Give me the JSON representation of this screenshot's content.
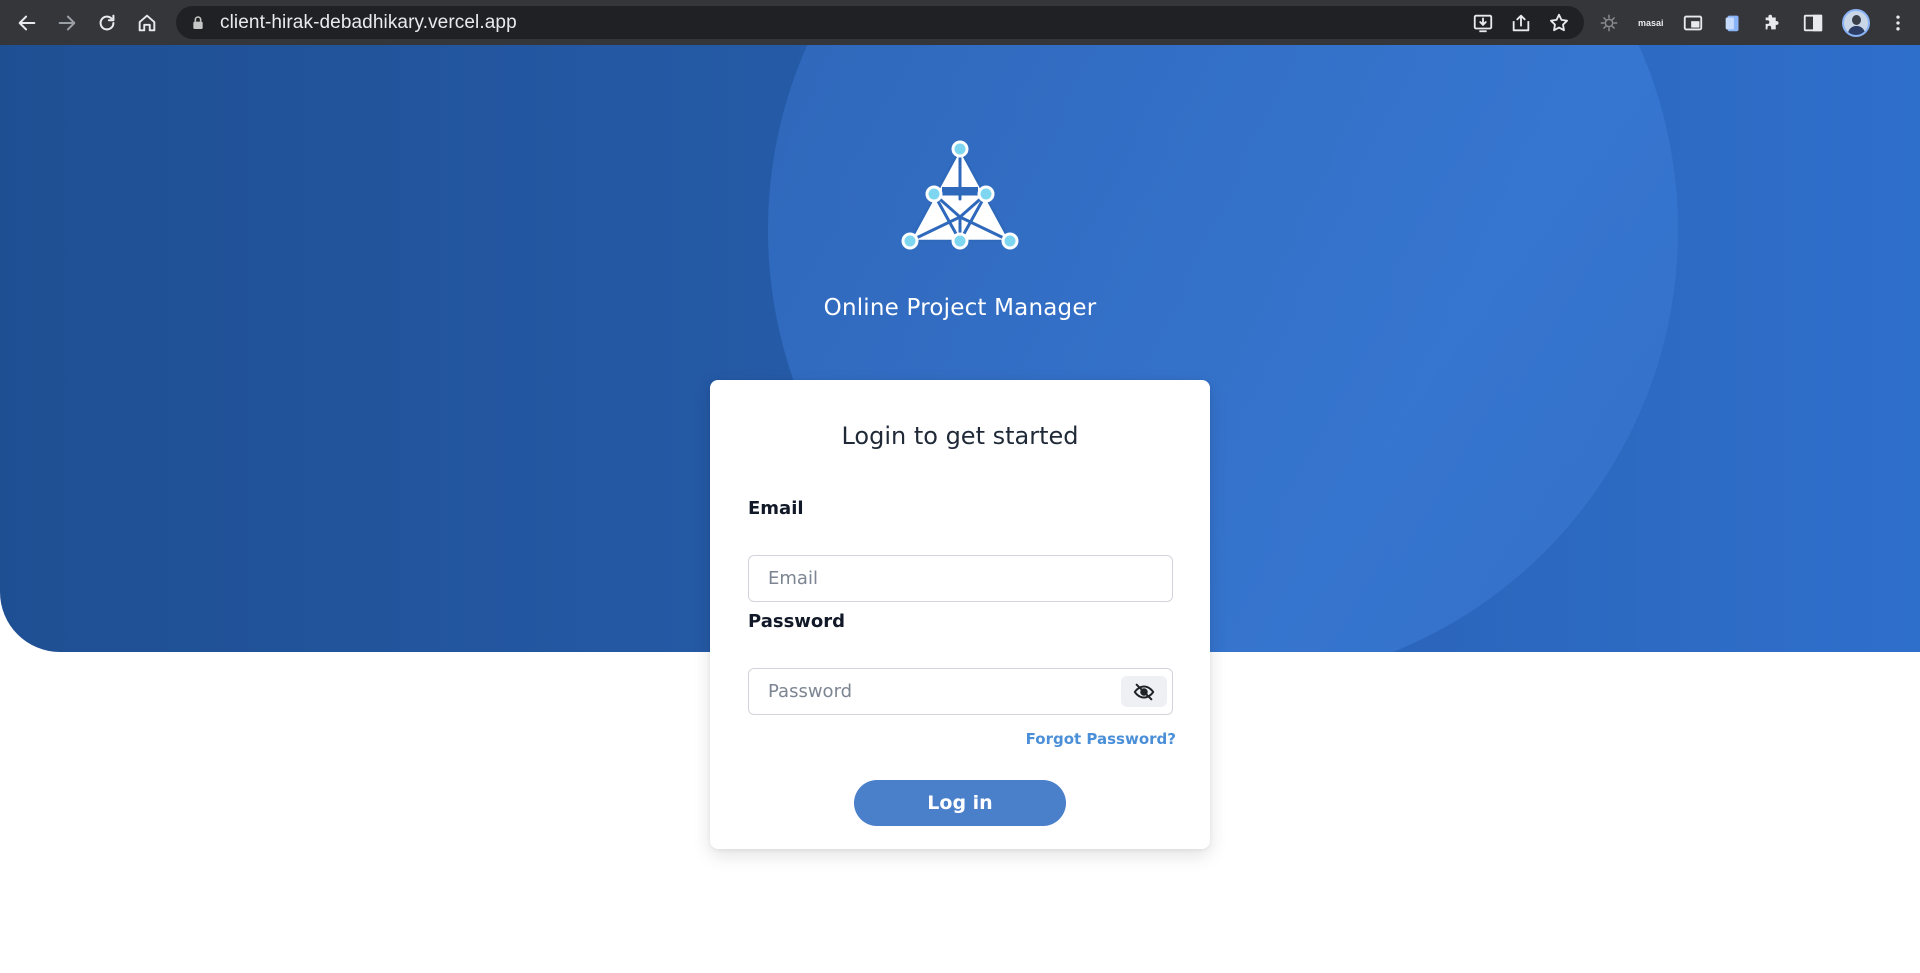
{
  "browser": {
    "url": "client-hirak-debadhikary.vercel.app",
    "extension_label": "masai",
    "icons": [
      "back-icon",
      "forward-icon",
      "reload-icon",
      "home-icon",
      "lock-icon",
      "install-icon",
      "share-icon",
      "star-icon",
      "extension-icon",
      "picture-in-picture-icon",
      "clipboard-icon",
      "puzzle-icon",
      "side-panel-icon",
      "avatar",
      "menu-icon"
    ]
  },
  "app": {
    "title": "Online Project Manager",
    "logo": "triangle-network-logo",
    "colors": {
      "hero_dark": "#1f4f93",
      "hero_light": "#2f6fcc",
      "accent": "#4a7fc9",
      "link": "#4a8fd8"
    }
  },
  "login": {
    "heading": "Login to get started",
    "email_label": "Email",
    "email_placeholder": "Email",
    "email_value": "",
    "password_label": "Password",
    "password_placeholder": "Password",
    "password_value": "",
    "forgot_label": "Forgot Password?",
    "submit_label": "Log in",
    "toggle_icon": "eye-slash-icon"
  }
}
